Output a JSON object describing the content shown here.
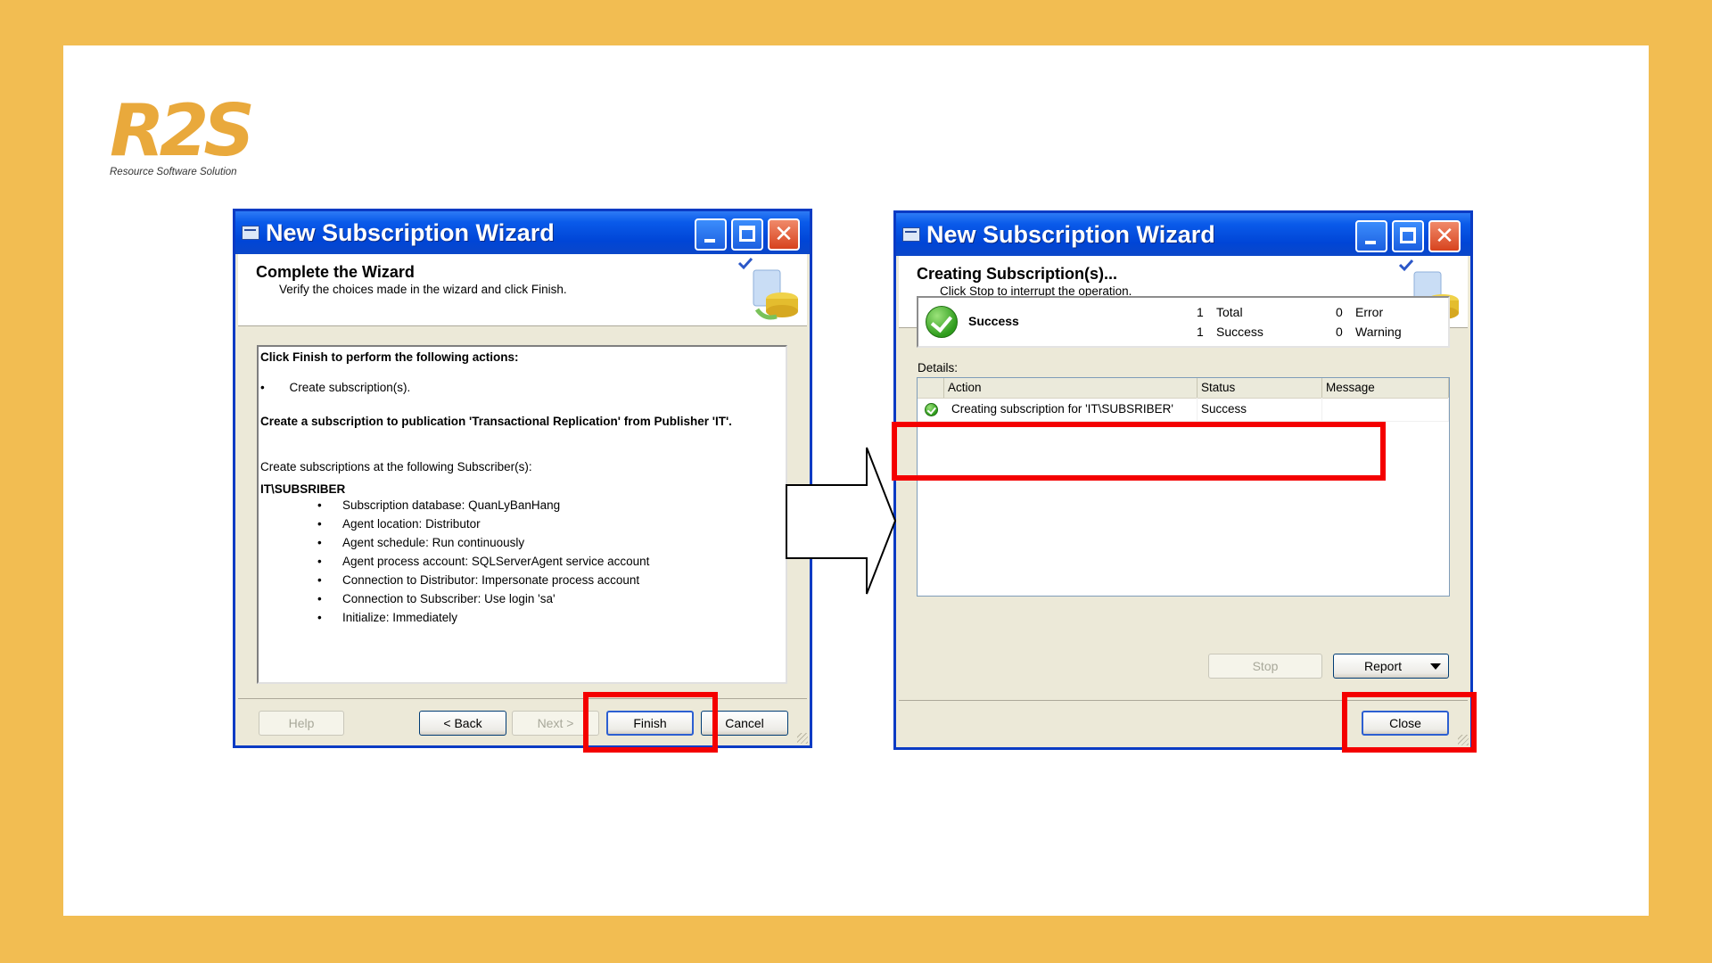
{
  "brand": {
    "logo_text": "R2S",
    "tagline": "Resource Software Solution",
    "logo_color": "#E9A93C"
  },
  "colors": {
    "background": "#F2BD52",
    "highlight": "#F40000",
    "titlebar": "#0A5BEA"
  },
  "left_window": {
    "title": "New Subscription Wizard",
    "header_title": "Complete the Wizard",
    "header_subtitle": "Verify the choices made in the wizard and click Finish.",
    "intro": "Click Finish to perform the following actions:",
    "actions": [
      "Create subscription(s)."
    ],
    "description": "Create a subscription to publication 'Transactional Replication' from Publisher 'IT'.",
    "subscribers_label": "Create subscriptions at the following Subscriber(s):",
    "subscriber_name": "IT\\SUBSRIBER",
    "subscriber_details": [
      "Subscription database: QuanLyBanHang",
      "Agent location: Distributor",
      "Agent schedule: Run continuously",
      "Agent process account: SQLServerAgent service account",
      "Connection to Distributor: Impersonate process account",
      "Connection to Subscriber: Use login 'sa'",
      "Initialize: Immediately"
    ],
    "buttons": {
      "help": "Help",
      "back": "< Back",
      "next": "Next >",
      "finish": "Finish",
      "cancel": "Cancel"
    }
  },
  "right_window": {
    "title": "New Subscription Wizard",
    "header_title": "Creating Subscription(s)...",
    "header_subtitle": "Click Stop to interrupt the operation.",
    "status": {
      "label": "Success",
      "total_count": "1",
      "total_label": "Total",
      "success_count": "1",
      "success_label": "Success",
      "error_count": "0",
      "error_label": "Error",
      "warning_count": "0",
      "warning_label": "Warning"
    },
    "details_label": "Details:",
    "columns": [
      "Action",
      "Status",
      "Message"
    ],
    "rows": [
      {
        "action": "Creating subscription for 'IT\\SUBSRIBER'",
        "status": "Success",
        "message": ""
      }
    ],
    "buttons": {
      "stop": "Stop",
      "report": "Report",
      "close": "Close"
    }
  }
}
